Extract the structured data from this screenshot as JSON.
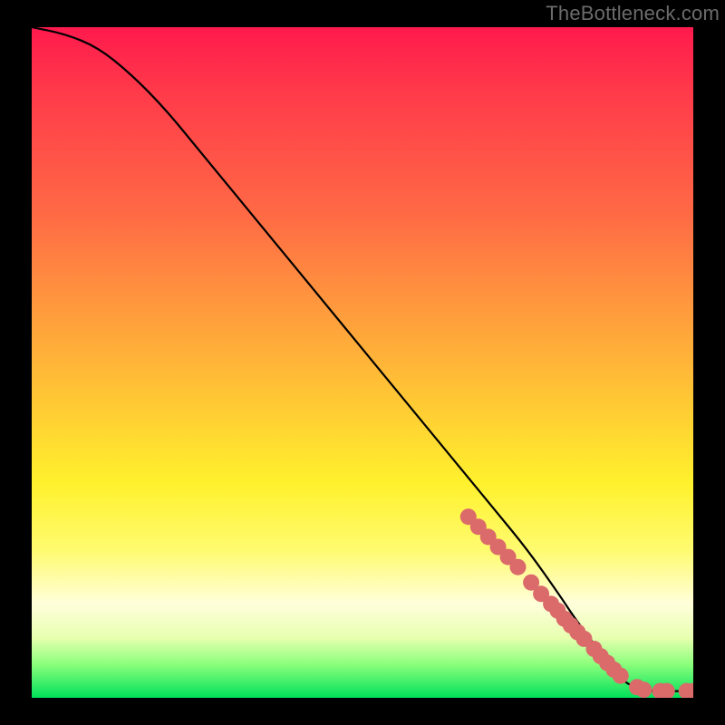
{
  "watermark": "TheBottleneck.com",
  "chart_data": {
    "type": "line",
    "title": "",
    "xlabel": "",
    "ylabel": "",
    "xlim": [
      0,
      100
    ],
    "ylim": [
      0,
      100
    ],
    "grid": false,
    "legend": false,
    "series": [
      {
        "name": "bottleneck-curve",
        "color": "#000000",
        "x": [
          0,
          5,
          10,
          15,
          20,
          25,
          30,
          35,
          40,
          45,
          50,
          55,
          60,
          65,
          70,
          75,
          80,
          82,
          85,
          88,
          90,
          93,
          96,
          100
        ],
        "y": [
          100,
          99,
          97,
          93,
          88,
          82,
          76,
          70,
          64,
          58,
          52,
          46,
          40,
          34,
          28,
          22,
          15,
          12,
          8,
          4,
          2,
          1,
          1,
          1
        ]
      }
    ],
    "points": {
      "name": "highlighted-points",
      "color": "#db6a6a",
      "radius_px": 9,
      "x": [
        66,
        67.5,
        69,
        70.5,
        72,
        73.5,
        75.5,
        77,
        78.5,
        79.5,
        80.5,
        81.5,
        82.5,
        83.5,
        85,
        86,
        87,
        88,
        89,
        91.5,
        92.5,
        95,
        96,
        99,
        100
      ],
      "y": [
        27,
        25.5,
        24,
        22.5,
        21,
        19.5,
        17.2,
        15.5,
        14,
        13,
        11.8,
        10.8,
        9.8,
        8.8,
        7.3,
        6.2,
        5.2,
        4.2,
        3.3,
        1.6,
        1.2,
        1,
        1,
        1,
        1
      ]
    },
    "gradient_stops": [
      {
        "pos": 0,
        "color": "#ff1a4d"
      },
      {
        "pos": 28,
        "color": "#ff6a45"
      },
      {
        "pos": 56,
        "color": "#ffc934"
      },
      {
        "pos": 78,
        "color": "#fffb70"
      },
      {
        "pos": 95,
        "color": "#8bff7c"
      },
      {
        "pos": 100,
        "color": "#00e05a"
      }
    ]
  }
}
